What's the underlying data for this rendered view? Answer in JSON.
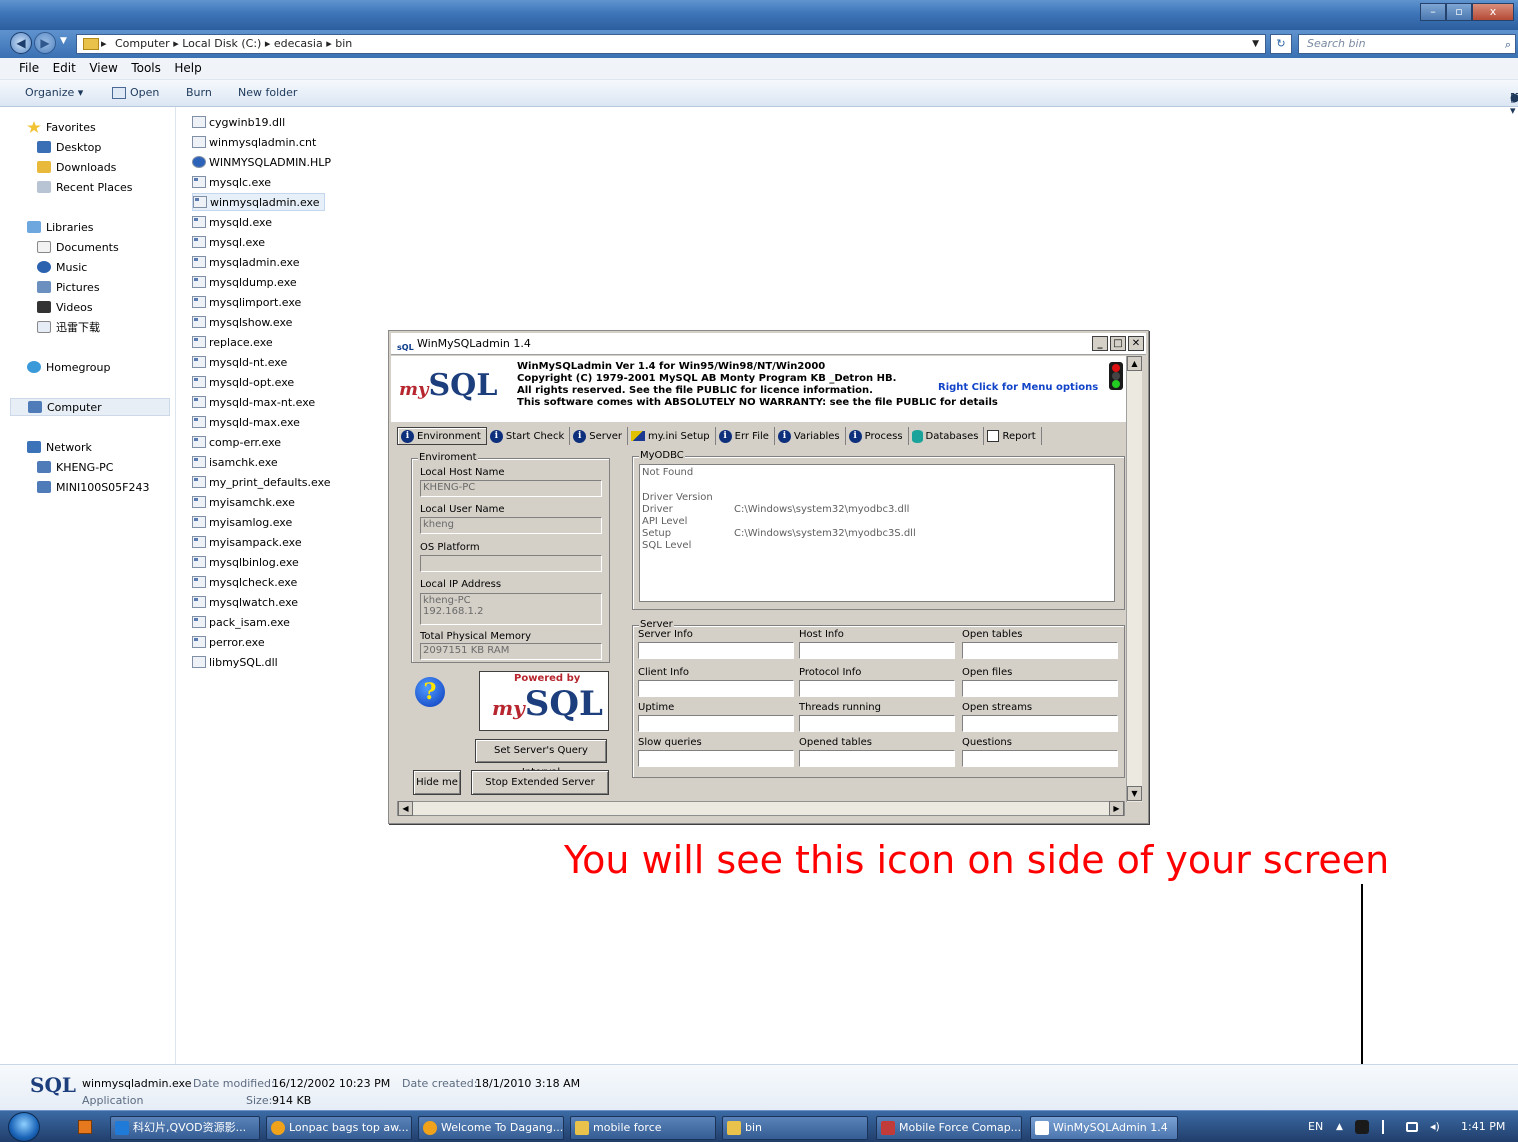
{
  "explorer": {
    "breadcrumb": [
      "Computer",
      "Local Disk (C:)",
      "edecasia",
      "bin"
    ],
    "search_placeholder": "Search bin",
    "menu": [
      "File",
      "Edit",
      "View",
      "Tools",
      "Help"
    ],
    "commands": [
      "Organize ▾",
      "Open",
      "Burn",
      "New folder"
    ],
    "nav": {
      "favorites": "Favorites",
      "favorites_items": [
        "Desktop",
        "Downloads",
        "Recent Places"
      ],
      "libraries": "Libraries",
      "libraries_items": [
        "Documents",
        "Music",
        "Pictures",
        "Videos",
        "迅雷下载"
      ],
      "homegroup": "Homegroup",
      "computer": "Computer",
      "network": "Network",
      "network_items": [
        "KHENG-PC",
        "MINI100S05F243"
      ]
    },
    "files": [
      "cygwinb19.dll",
      "winmysqladmin.cnt",
      "WINMYSQLADMIN.HLP",
      "mysqlc.exe",
      "winmysqladmin.exe",
      "mysqld.exe",
      "mysql.exe",
      "mysqladmin.exe",
      "mysqldump.exe",
      "mysqlimport.exe",
      "mysqlshow.exe",
      "replace.exe",
      "mysqld-nt.exe",
      "mysqld-opt.exe",
      "mysqld-max-nt.exe",
      "mysqld-max.exe",
      "comp-err.exe",
      "isamchk.exe",
      "my_print_defaults.exe",
      "myisamchk.exe",
      "myisamlog.exe",
      "myisampack.exe",
      "mysqlbinlog.exe",
      "mysqlcheck.exe",
      "mysqlwatch.exe",
      "pack_isam.exe",
      "perror.exe",
      "libmySQL.dll"
    ],
    "selected_file": "winmysqladmin.exe",
    "details": {
      "name": "winmysqladmin.exe",
      "type": "Application",
      "modified_label": "Date modified:",
      "modified": "16/12/2002 10:23 PM",
      "created_label": "Date created:",
      "created": "18/1/2010 3:18 AM",
      "size_label": "Size:",
      "size": "914 KB"
    }
  },
  "winmysql": {
    "title": "WinMySQLadmin 1.4",
    "header": [
      "WinMySQLadmin Ver 1.4 for Win95/Win98/NT/Win2000",
      "Copyright (C) 1979-2001 MySQL AB  Monty Program KB _Detron HB.",
      "All rights reserved. See the file PUBLIC for licence information.",
      "This software comes with ABSOLUTELY NO WARRANTY: see the file PUBLIC for details"
    ],
    "right_click": "Right Click for Menu options",
    "logo_my": "my",
    "logo_sql": "SQL",
    "tabs": [
      "Environment",
      "Start Check",
      "Server",
      "my.ini Setup",
      "Err File",
      "Variables",
      "Process",
      "Databases",
      "Report"
    ],
    "env": {
      "group": "Enviroment",
      "host_label": "Local Host Name",
      "host": "KHENG-PC",
      "user_label": "Local User Name",
      "user": "kheng",
      "os_label": "OS Platform",
      "os": "",
      "ip_label": "Local IP Address",
      "ip": "kheng-PC\n192.168.1.2",
      "mem_label": "Total Physical Memory",
      "mem": "2097151 KB RAM"
    },
    "odbc": {
      "group": "MyODBC",
      "status": "Not Found",
      "driver_version": "Driver Version",
      "driver": "Driver",
      "driver_path": "C:\\Windows\\system32\\myodbc3.dll",
      "api_level": "API Level",
      "setup": "Setup",
      "setup_path": "C:\\Windows\\system32\\myodbc3S.dll",
      "sql_level": "SQL Level"
    },
    "server": {
      "group": "Server",
      "labels": [
        "Server Info",
        "Host Info",
        "Open tables",
        "Client Info",
        "Protocol Info",
        "Open files",
        "Uptime",
        "Threads running",
        "Open streams",
        "Slow queries",
        "Opened tables",
        "Questions"
      ]
    },
    "powered_by": "Powered by",
    "help_glyph": "?",
    "buttons": {
      "set_interval": "Set Server's Query Interval",
      "hide": "Hide me",
      "stop": "Stop Extended Server Status"
    }
  },
  "annotation": "You will see this icon on side of your screen",
  "taskbar": {
    "buttons": [
      "科幻片,QVOD资源影...",
      "Lonpac bags top aw...",
      "Welcome To Dagang...",
      "mobile force",
      "bin",
      "Mobile Force Comap...",
      "WinMySQLAdmin 1.4"
    ],
    "lang": "EN",
    "time": "1:41 PM"
  }
}
